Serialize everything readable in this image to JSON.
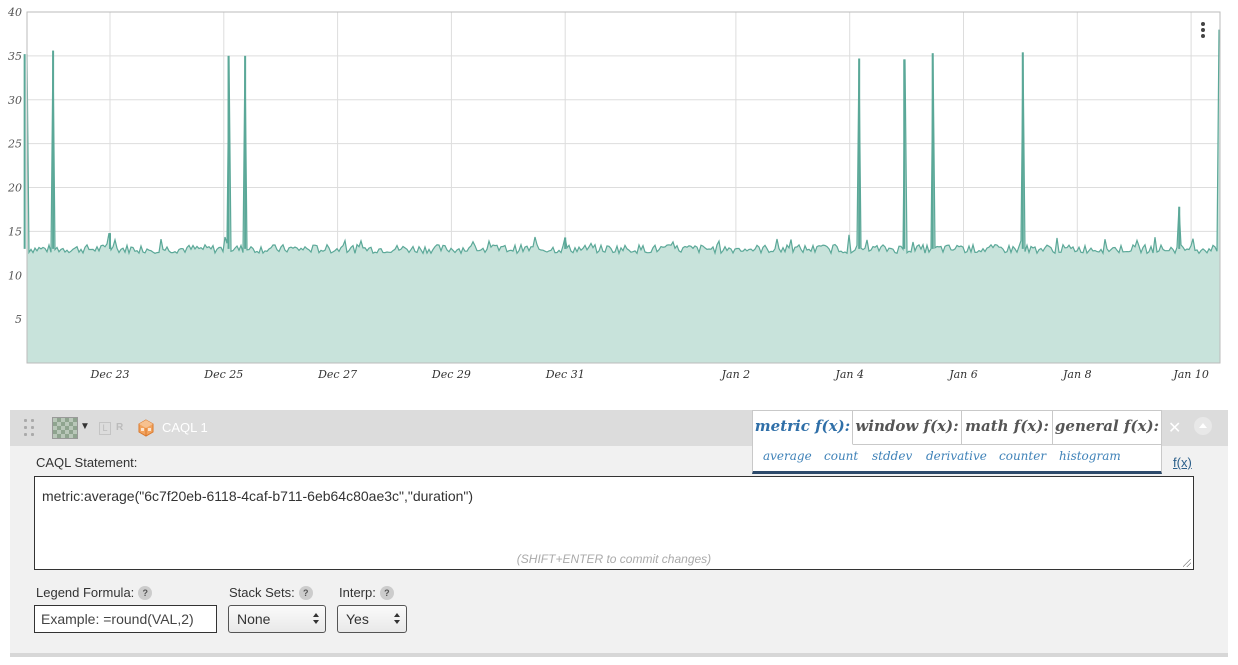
{
  "chart_data": {
    "type": "area",
    "title": "",
    "xlabel": "",
    "ylabel": "",
    "ylim": [
      0,
      40
    ],
    "y_ticks": [
      "5",
      "10",
      "15",
      "20",
      "25",
      "30",
      "35",
      "40"
    ],
    "x_ticks": [
      "Dec 23",
      "Dec 25",
      "Dec 27",
      "Dec 29",
      "Dec 31",
      "Jan 2",
      "Jan 4",
      "Jan 6",
      "Jan 8",
      "Jan 10"
    ],
    "grid": true,
    "baseline": 13,
    "series": [
      {
        "values_note": "",
        "color": "#5ba898",
        "fill": "#c8e3db",
        "spikes": [
          {
            "date": "Dec 21 12:00",
            "value": 35.2
          },
          {
            "date": "Dec 22 00:00",
            "value": 35.6
          },
          {
            "date": "Dec 23 00:00",
            "value": 14.8
          },
          {
            "date": "Dec 25 02:00",
            "value": 35.0
          },
          {
            "date": "Dec 25 09:00",
            "value": 35.0
          },
          {
            "date": "Dec 31 00:00",
            "value": 14.3
          },
          {
            "date": "Jan 4 04:00",
            "value": 34.7
          },
          {
            "date": "Jan 4 23:00",
            "value": 34.6
          },
          {
            "date": "Jan 5 11:00",
            "value": 35.3
          },
          {
            "date": "Jan 7 01:00",
            "value": 35.4
          },
          {
            "date": "Jan 9 19:00",
            "value": 17.8
          },
          {
            "date": "Jan 11 12:00",
            "value": 36.0
          },
          {
            "date": "Jan 11 16:00",
            "value": 38.0
          }
        ]
      }
    ]
  },
  "panel": {
    "series_name": "CAQL 1",
    "axis_left": "L",
    "axis_right": "R",
    "caql_label": "CAQL Statement:",
    "caql_statement": "metric:average(\"6c7f20eb-6118-4caf-b711-6eb64c80ae3c\",\"duration\")",
    "caql_hint": "(SHIFT+ENTER to commit changes)",
    "fx_link": "f(x)",
    "close_glyph": "✕",
    "legend_label": "Legend Formula:",
    "legend_placeholder": "Example: =round(VAL,2)",
    "stack_label": "Stack Sets:",
    "stack_value": "None",
    "interp_label": "Interp:",
    "interp_value": "Yes",
    "help": "?"
  },
  "fx_menu": {
    "tabs": [
      "metric f(x):",
      "window f(x):",
      "math f(x):",
      "general f(x):"
    ],
    "active_tab": "metric f(x):",
    "items": [
      "average",
      "count",
      "stddev",
      "derivative",
      "counter",
      "histogram"
    ]
  },
  "colors": {
    "line": "#5ba898",
    "fill": "#c8e3db",
    "accent": "#2f6fa8"
  }
}
